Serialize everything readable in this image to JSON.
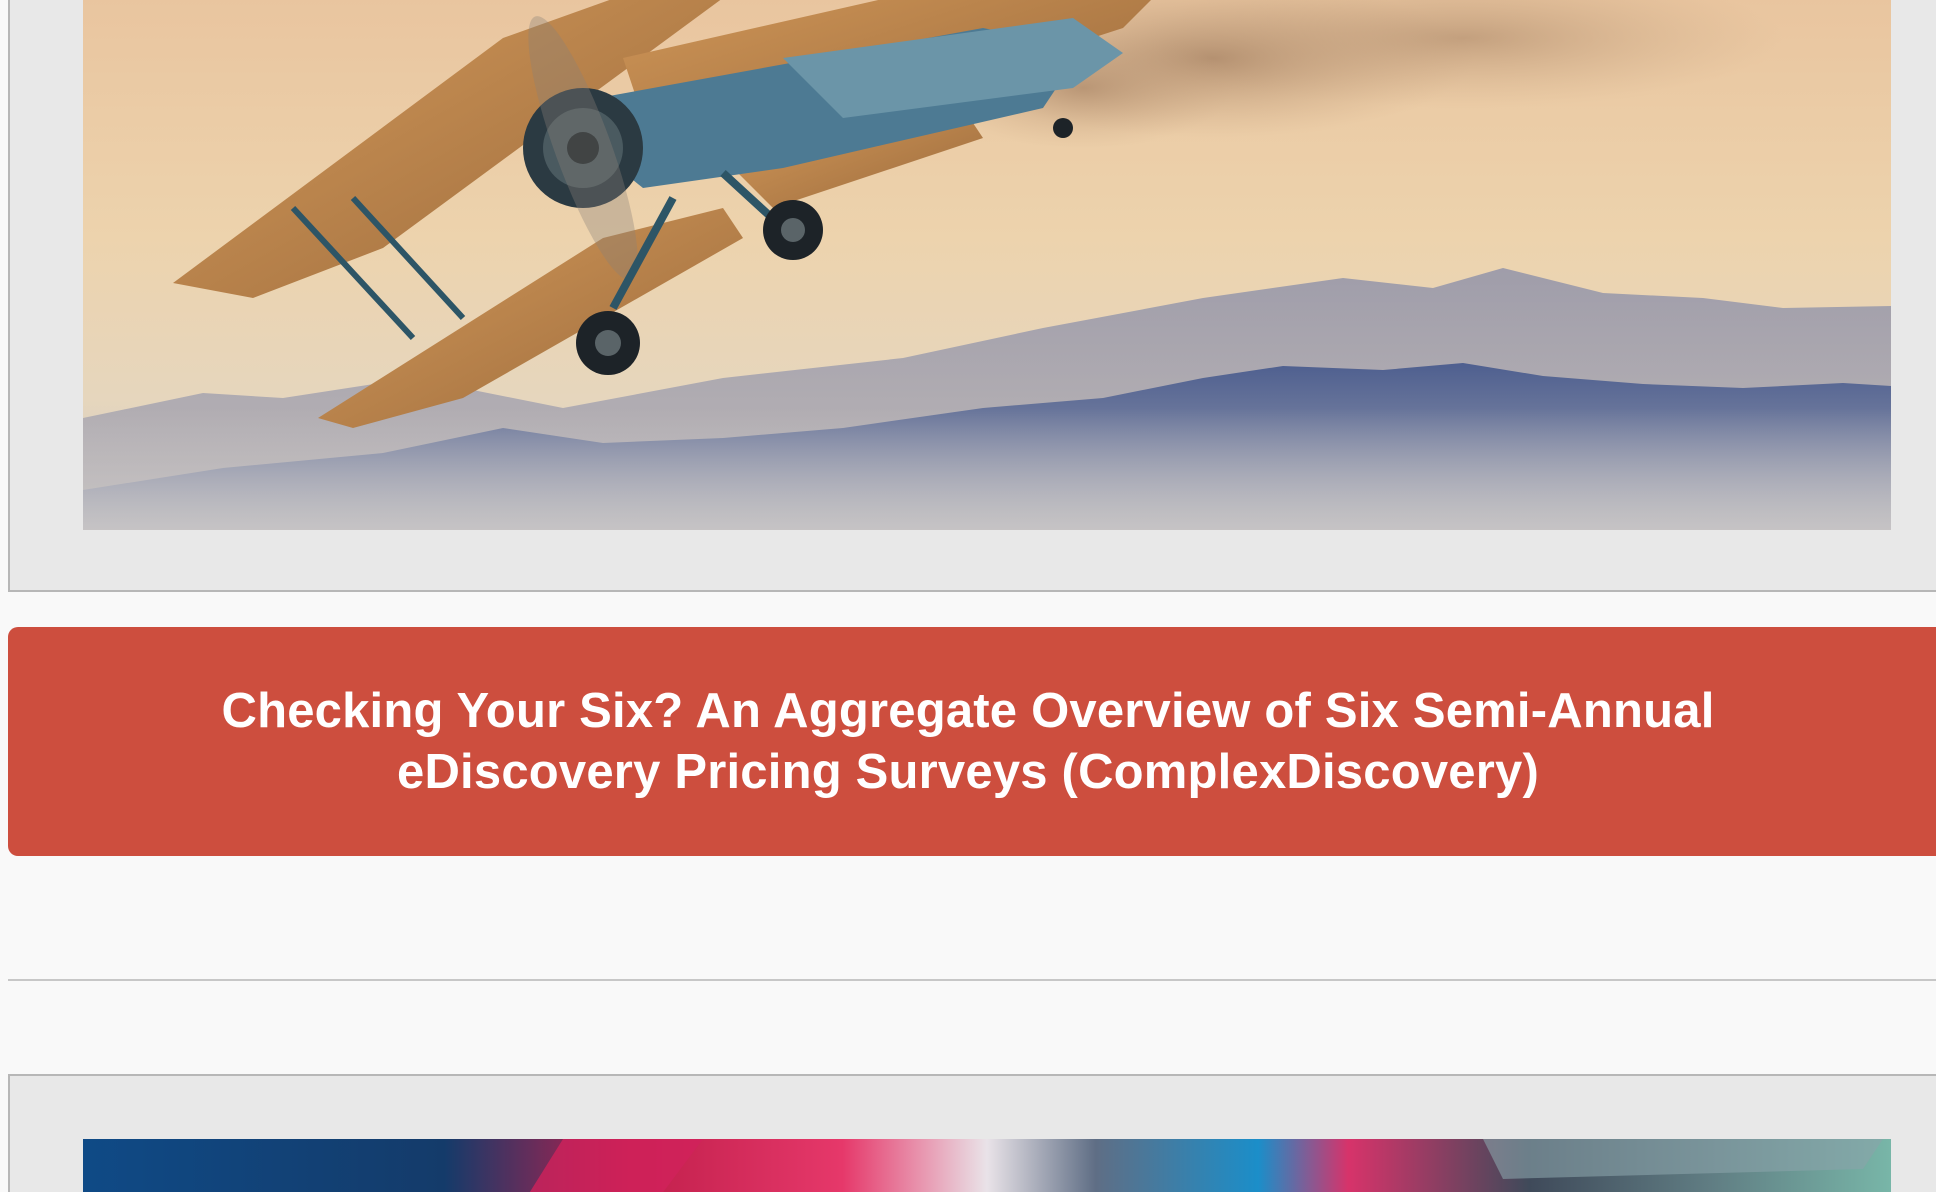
{
  "post": {
    "title": "Checking Your Six? An Aggregate Overview of Six Semi-Annual eDiscovery Pricing Surveys (ComplexDiscovery)",
    "hero_image": "biplane-over-mountains-image"
  },
  "next_post": {
    "image": "colorful-abstract-image"
  },
  "colors": {
    "banner": "#cd4e3e",
    "card_background": "#e8e8e8",
    "page_background": "#f9f9f9",
    "title_text": "#ffffff"
  }
}
